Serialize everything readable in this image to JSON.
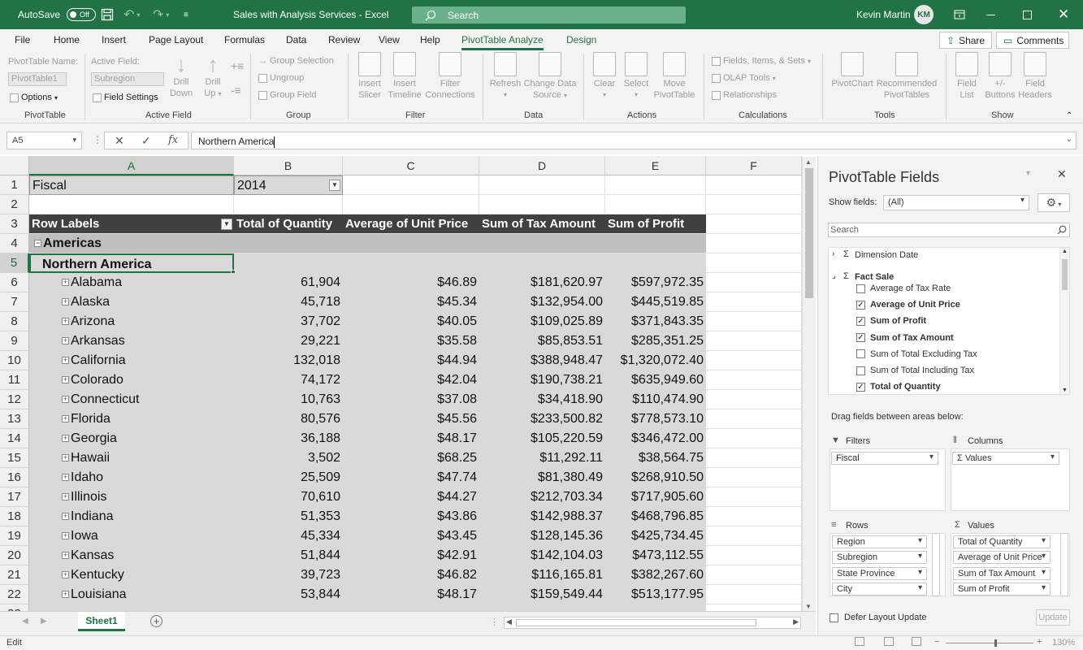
{
  "window": {
    "autosave_label": "AutoSave",
    "autosave_state": "Off",
    "title": "Sales with Analysis Services  -  Excel",
    "search_placeholder": "Search",
    "user_name": "Kevin Martin",
    "user_initials": "KM"
  },
  "ribbon_tabs": [
    "File",
    "Home",
    "Insert",
    "Page Layout",
    "Formulas",
    "Data",
    "Review",
    "View",
    "Help",
    "PivotTable Analyze",
    "Design"
  ],
  "share_label": "Share",
  "comments_label": "Comments",
  "ribbon": {
    "pt_name_label": "PivotTable Name:",
    "pt_name_value": "PivotTable1",
    "options": "Options",
    "group_pivottable": "PivotTable",
    "active_field_label": "Active Field:",
    "active_field_value": "Subregion",
    "field_settings": "Field Settings",
    "drill_down": [
      "Drill",
      "Down"
    ],
    "drill_up": [
      "Drill",
      "Up"
    ],
    "group_active_field": "Active Field",
    "group_selection": "Group Selection",
    "ungroup": "Ungroup",
    "group_field": "Group Field",
    "group_group": "Group",
    "insert_slicer": [
      "Insert",
      "Slicer"
    ],
    "insert_timeline": [
      "Insert",
      "Timeline"
    ],
    "filter_connections": [
      "Filter",
      "Connections"
    ],
    "group_filter": "Filter",
    "refresh": "Refresh",
    "change_data_source": [
      "Change Data",
      "Source"
    ],
    "group_data": "Data",
    "clear": "Clear",
    "select": "Select",
    "move_pivottable": [
      "Move",
      "PivotTable"
    ],
    "group_actions": "Actions",
    "fields_items_sets": "Fields, Items, & Sets",
    "olap_tools": "OLAP Tools",
    "relationships": "Relationships",
    "group_calculations": "Calculations",
    "pivotchart": "PivotChart",
    "recommended_pivottables": [
      "Recommended",
      "PivotTables"
    ],
    "group_tools": "Tools",
    "field_list": [
      "Field",
      "List"
    ],
    "plus_minus_buttons": [
      "+/-",
      "Buttons"
    ],
    "field_headers": [
      "Field",
      "Headers"
    ],
    "group_show": "Show"
  },
  "formula_bar": {
    "name_box": "A5",
    "fx": "fx",
    "formula": "Northern America"
  },
  "columns": [
    "A",
    "B",
    "C",
    "D",
    "E",
    "F"
  ],
  "sheet": {
    "fiscal_label": "Fiscal",
    "fiscal_value": "2014",
    "row_labels": "Row Labels",
    "headers": [
      "Total of Quantity",
      "Average of Unit Price",
      "Sum of Tax Amount",
      "Sum of Profit"
    ],
    "americas": "Americas",
    "northern_america": "Northern America",
    "rows": [
      {
        "state": "Alabama",
        "qty": "61,904",
        "price": "$46.89",
        "tax": "$181,620.97",
        "profit": "$597,972.35"
      },
      {
        "state": "Alaska",
        "qty": "45,718",
        "price": "$45.34",
        "tax": "$132,954.00",
        "profit": "$445,519.85"
      },
      {
        "state": "Arizona",
        "qty": "37,702",
        "price": "$40.05",
        "tax": "$109,025.89",
        "profit": "$371,843.35"
      },
      {
        "state": "Arkansas",
        "qty": "29,221",
        "price": "$35.58",
        "tax": "$85,853.51",
        "profit": "$285,351.25"
      },
      {
        "state": "California",
        "qty": "132,018",
        "price": "$44.94",
        "tax": "$388,948.47",
        "profit": "$1,320,072.40"
      },
      {
        "state": "Colorado",
        "qty": "74,172",
        "price": "$42.04",
        "tax": "$190,738.21",
        "profit": "$635,949.60"
      },
      {
        "state": "Connecticut",
        "qty": "10,763",
        "price": "$37.08",
        "tax": "$34,418.90",
        "profit": "$110,474.90"
      },
      {
        "state": "Florida",
        "qty": "80,576",
        "price": "$45.56",
        "tax": "$233,500.82",
        "profit": "$778,573.10"
      },
      {
        "state": "Georgia",
        "qty": "36,188",
        "price": "$48.17",
        "tax": "$105,220.59",
        "profit": "$346,472.00"
      },
      {
        "state": "Hawaii",
        "qty": "3,502",
        "price": "$68.25",
        "tax": "$11,292.11",
        "profit": "$38,564.75"
      },
      {
        "state": "Idaho",
        "qty": "25,509",
        "price": "$47.74",
        "tax": "$81,380.49",
        "profit": "$268,910.50"
      },
      {
        "state": "Illinois",
        "qty": "70,610",
        "price": "$44.27",
        "tax": "$212,703.34",
        "profit": "$717,905.60"
      },
      {
        "state": "Indiana",
        "qty": "51,353",
        "price": "$43.86",
        "tax": "$142,988.37",
        "profit": "$468,796.85"
      },
      {
        "state": "Iowa",
        "qty": "45,334",
        "price": "$43.45",
        "tax": "$128,145.36",
        "profit": "$425,734.45"
      },
      {
        "state": "Kansas",
        "qty": "51,844",
        "price": "$42.91",
        "tax": "$142,104.03",
        "profit": "$473,112.55"
      },
      {
        "state": "Kentucky",
        "qty": "39,723",
        "price": "$46.82",
        "tax": "$116,165.81",
        "profit": "$382,267.60"
      },
      {
        "state": "Louisiana",
        "qty": "53,844",
        "price": "$48.17",
        "tax": "$159,549.44",
        "profit": "$513,177.95"
      }
    ],
    "sheet_tab": "Sheet1"
  },
  "status_bar": {
    "mode": "Edit",
    "zoom": "130%"
  },
  "pivot_pane": {
    "title": "PivotTable Fields",
    "show_fields_label": "Show fields:",
    "show_fields_value": "(All)",
    "search_placeholder": "Search",
    "dimension_date": "Dimension Date",
    "fact_sale": "Fact Sale",
    "fields": [
      {
        "name": "Average of Tax Rate",
        "checked": false
      },
      {
        "name": "Average of Unit Price",
        "checked": true
      },
      {
        "name": "Sum of Profit",
        "checked": true
      },
      {
        "name": "Sum of Tax Amount",
        "checked": true
      },
      {
        "name": "Sum of Total Excluding Tax",
        "checked": false
      },
      {
        "name": "Sum of Total Including Tax",
        "checked": false
      },
      {
        "name": "Total of Quantity",
        "checked": true
      }
    ],
    "drag_hint": "Drag fields between areas below:",
    "filters_label": "Filters",
    "columns_label": "Columns",
    "rows_label": "Rows",
    "values_label": "Values",
    "filters": [
      "Fiscal"
    ],
    "columns": [
      "Values"
    ],
    "rows": [
      "Region",
      "Subregion",
      "State Province",
      "City"
    ],
    "values": [
      "Total of Quantity",
      "Average of Unit Price",
      "Sum of Tax Amount",
      "Sum of Profit"
    ],
    "defer_label": "Defer Layout Update",
    "update_label": "Update"
  },
  "colors": {
    "accent": "#217346",
    "pivot_header": "#404040",
    "pivot_body": "#d9d9d9",
    "pivot_group": "#bfbfbf"
  }
}
